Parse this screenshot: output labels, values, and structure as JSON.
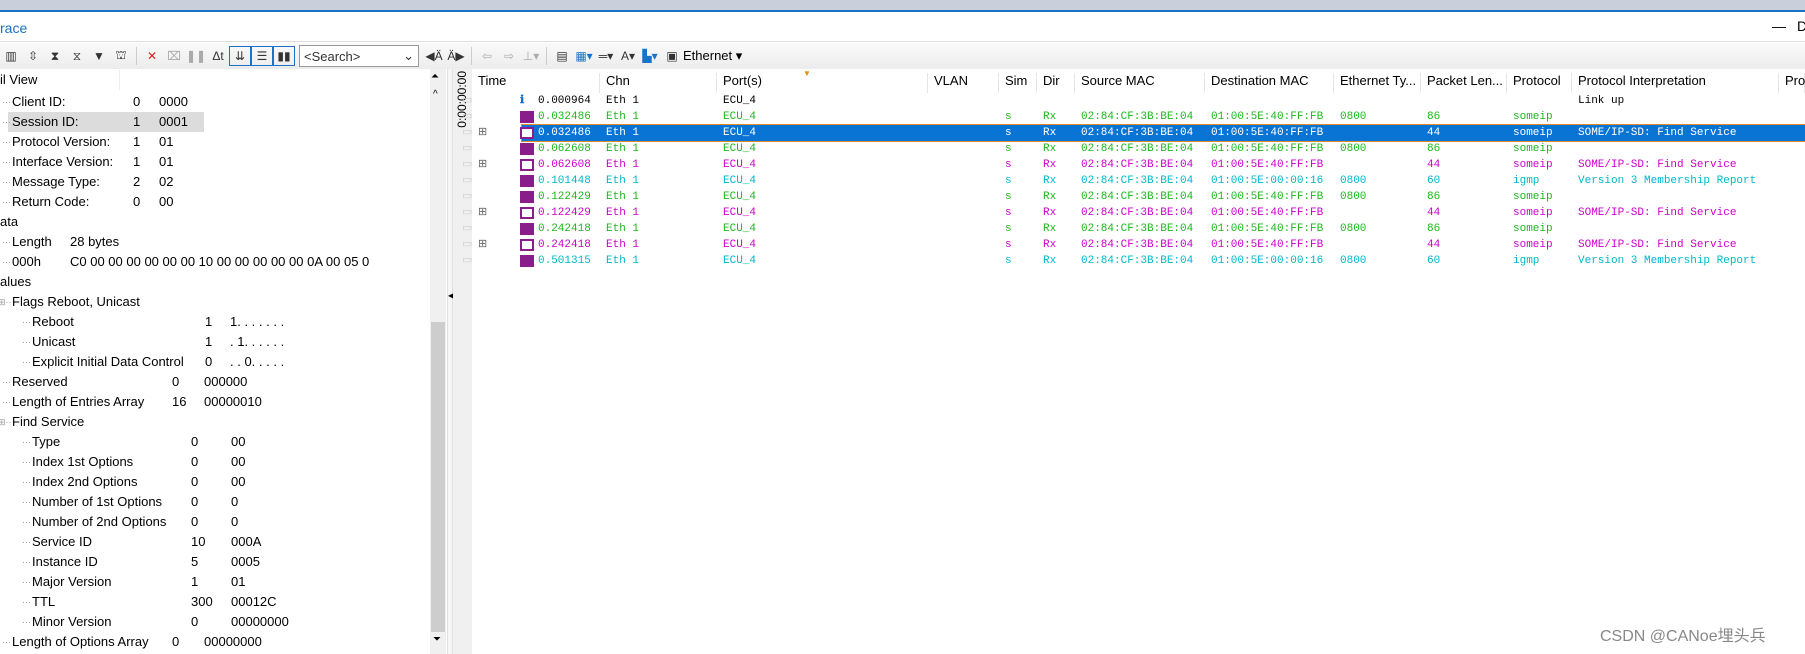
{
  "window": {
    "title": "race",
    "min_label": "—",
    "max_label": "D"
  },
  "toolbar": {
    "search_placeholder": "<Search>",
    "bus_filter": "Ethernet",
    "icons": [
      "chart-icon",
      "scroll-icon",
      "filter-icon",
      "filter2-icon",
      "filter-down-icon",
      "binoculars-icon",
      "delete-icon",
      "clear-icon",
      "pause-icon",
      "delta-time-icon",
      "auto-scroll-icon",
      "detail-icon",
      "column-icon",
      "find-prev-icon",
      "find-next-icon",
      "back-icon",
      "forward-icon",
      "insert-icon",
      "window-icon",
      "color-icon",
      "separator-icon",
      "font-size-icon",
      "layout-icon",
      "ethernet-icon"
    ]
  },
  "detail": {
    "header": "il View",
    "rows": [
      {
        "label": "Client ID:",
        "v1": "0",
        "v2": "0000",
        "g": "a"
      },
      {
        "label": "Session ID:",
        "v1": "1",
        "v2": "0001",
        "g": "a",
        "selected": true
      },
      {
        "label": "Protocol Version:",
        "v1": "1",
        "v2": "01",
        "g": "a"
      },
      {
        "label": "Interface Version:",
        "v1": "1",
        "v2": "01",
        "g": "a"
      },
      {
        "label": "Message Type:",
        "v1": "2",
        "v2": "02",
        "g": "a"
      },
      {
        "label": "Return Code:",
        "v1": "0",
        "v2": "00",
        "g": "a"
      },
      {
        "label": "ata",
        "g": "h"
      },
      {
        "label": "Length",
        "v1": "28 bytes",
        "g": "d"
      },
      {
        "label": "000h",
        "v1": "C0  00  00  00  00  00  00  10  00  00  00  00  00  0A  00  05  0",
        "g": "d"
      },
      {
        "label": "alues",
        "g": "h"
      },
      {
        "label": "Flags Reboot, Unicast",
        "g": "e"
      },
      {
        "label": "Reboot",
        "v1": "1",
        "v2": "1. . .  . . . .",
        "g": "f"
      },
      {
        "label": "Unicast",
        "v1": "1",
        "v2": ". 1. .  . . . .",
        "g": "f"
      },
      {
        "label": "Explicit Initial Data Control",
        "v1": "0",
        "v2": ". . 0.  . . . .",
        "g": "f"
      },
      {
        "label": "Reserved",
        "v1": "0",
        "v2": "000000",
        "g": "r"
      },
      {
        "label": "Length of Entries Array",
        "v1": "16",
        "v2": "00000010",
        "g": "r"
      },
      {
        "label": "Find Service",
        "g": "e"
      },
      {
        "label": "Type",
        "v1": "0",
        "v2": "00",
        "g": "s"
      },
      {
        "label": "Index 1st Options",
        "v1": "0",
        "v2": "00",
        "g": "s"
      },
      {
        "label": "Index 2nd Options",
        "v1": "0",
        "v2": "00",
        "g": "s"
      },
      {
        "label": "Number of 1st Options",
        "v1": "0",
        "v2": "0",
        "g": "s"
      },
      {
        "label": "Number of 2nd Options",
        "v1": "0",
        "v2": "0",
        "g": "s"
      },
      {
        "label": "Service ID",
        "v1": "10",
        "v2": "000A",
        "g": "s"
      },
      {
        "label": "Instance ID",
        "v1": "5",
        "v2": "0005",
        "g": "s"
      },
      {
        "label": "Major Version",
        "v1": "1",
        "v2": "01",
        "g": "s"
      },
      {
        "label": "TTL",
        "v1": "300",
        "v2": "00012C",
        "g": "s"
      },
      {
        "label": "Minor Version",
        "v1": "0",
        "v2": "00000000",
        "g": "s"
      },
      {
        "label": "Length of Options Array",
        "v1": "0",
        "v2": "00000000",
        "g": "r"
      }
    ]
  },
  "ruler": {
    "label": "0:00:00:00"
  },
  "trace": {
    "columns": [
      "Time",
      "Chn",
      "Port(s)",
      "VLAN",
      "Sim",
      "Dir",
      "Source MAC",
      "Destination MAC",
      "Ethernet Ty...",
      "Packet Len...",
      "Protocol",
      "Protocol Interpretation",
      "Pro"
    ],
    "colors": {
      "black": "#000000",
      "green": "#1db81d",
      "magenta": "#cc00cc",
      "cyan": "#00b8c8",
      "selected": "#0a74d4"
    },
    "rows": [
      {
        "icon": "info-icon",
        "expand": false,
        "color": "black",
        "cells": [
          "0.000964",
          "Eth 1",
          "ECU_4",
          "",
          "",
          "",
          "",
          "",
          "",
          "",
          "",
          "Link up"
        ]
      },
      {
        "icon": "frame-icon",
        "expand": false,
        "color": "green",
        "cells": [
          "0.032486",
          "Eth 1",
          "ECU_4",
          "",
          "s",
          "Rx",
          "02:84:CF:3B:BE:04",
          "01:00:5E:40:FF:FB",
          "0800",
          "86",
          "someip",
          ""
        ]
      },
      {
        "icon": "message-icon",
        "expand": true,
        "color": "black",
        "selected": true,
        "cells": [
          "0.032486",
          "Eth 1",
          "ECU_4",
          "",
          "s",
          "Rx",
          "02:84:CF:3B:BE:04",
          "01:00:5E:40:FF:FB",
          "",
          "44",
          "someip",
          "SOME/IP-SD: Find Service"
        ]
      },
      {
        "icon": "frame-icon",
        "expand": false,
        "color": "green",
        "cells": [
          "0.062608",
          "Eth 1",
          "ECU_4",
          "",
          "s",
          "Rx",
          "02:84:CF:3B:BE:04",
          "01:00:5E:40:FF:FB",
          "0800",
          "86",
          "someip",
          ""
        ]
      },
      {
        "icon": "message-icon",
        "expand": true,
        "color": "magenta",
        "cells": [
          "0.062608",
          "Eth 1",
          "ECU_4",
          "",
          "s",
          "Rx",
          "02:84:CF:3B:BE:04",
          "01:00:5E:40:FF:FB",
          "",
          "44",
          "someip",
          "SOME/IP-SD: Find Service"
        ]
      },
      {
        "icon": "packet-icon",
        "expand": false,
        "color": "cyan",
        "cells": [
          "0.101448",
          "Eth 1",
          "ECU_4",
          "",
          "s",
          "Rx",
          "02:84:CF:3B:BE:04",
          "01:00:5E:00:00:16",
          "0800",
          "60",
          "igmp",
          "Version 3 Membership Report"
        ]
      },
      {
        "icon": "frame-icon",
        "expand": false,
        "color": "green",
        "cells": [
          "0.122429",
          "Eth 1",
          "ECU_4",
          "",
          "s",
          "Rx",
          "02:84:CF:3B:BE:04",
          "01:00:5E:40:FF:FB",
          "0800",
          "86",
          "someip",
          ""
        ]
      },
      {
        "icon": "message-icon",
        "expand": true,
        "color": "magenta",
        "cells": [
          "0.122429",
          "Eth 1",
          "ECU_4",
          "",
          "s",
          "Rx",
          "02:84:CF:3B:BE:04",
          "01:00:5E:40:FF:FB",
          "",
          "44",
          "someip",
          "SOME/IP-SD: Find Service"
        ]
      },
      {
        "icon": "frame-icon",
        "expand": false,
        "color": "green",
        "cells": [
          "0.242418",
          "Eth 1",
          "ECU_4",
          "",
          "s",
          "Rx",
          "02:84:CF:3B:BE:04",
          "01:00:5E:40:FF:FB",
          "0800",
          "86",
          "someip",
          ""
        ]
      },
      {
        "icon": "message-icon",
        "expand": true,
        "color": "magenta",
        "cells": [
          "0.242418",
          "Eth 1",
          "ECU_4",
          "",
          "s",
          "Rx",
          "02:84:CF:3B:BE:04",
          "01:00:5E:40:FF:FB",
          "",
          "44",
          "someip",
          "SOME/IP-SD: Find Service"
        ]
      },
      {
        "icon": "packet-icon",
        "expand": false,
        "color": "cyan",
        "cells": [
          "0.501315",
          "Eth 1",
          "ECU_4",
          "",
          "s",
          "Rx",
          "02:84:CF:3B:BE:04",
          "01:00:5E:00:00:16",
          "0800",
          "60",
          "igmp",
          "Version 3 Membership Report"
        ]
      }
    ]
  },
  "watermark": "CSDN @CANoe埋头兵"
}
